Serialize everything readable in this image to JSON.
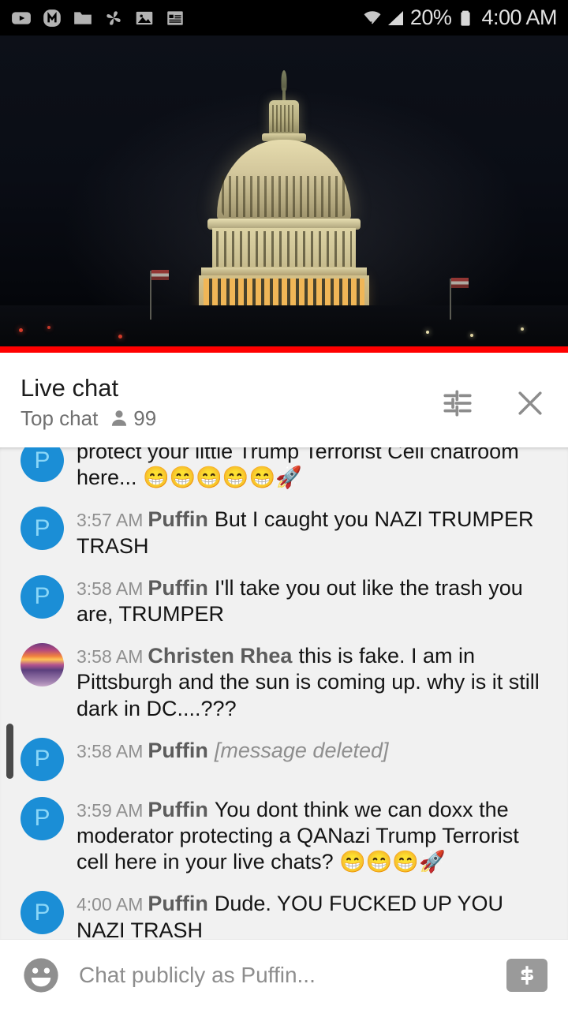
{
  "status_bar": {
    "background": "#000000",
    "left_icons": [
      {
        "name": "youtube-icon",
        "label": "YouTube"
      },
      {
        "name": "messenger-m-icon",
        "label": "M"
      },
      {
        "name": "folder-icon",
        "label": "Folder"
      },
      {
        "name": "photos-pinwheel-icon",
        "label": "Photos"
      },
      {
        "name": "image-icon",
        "label": "Gallery"
      },
      {
        "name": "notepad-icon",
        "label": "Notes"
      }
    ],
    "wifi_icon": "wifi-data-icon",
    "signal_icon": "cell-signal-icon",
    "battery_percent": "20%",
    "battery_icon": "battery-icon",
    "clock": "4:00 AM"
  },
  "video": {
    "name": "us-capitol-dome-night-livestream",
    "progress_color": "#ff0000",
    "progress_percent": 100
  },
  "chat_header": {
    "title": "Live chat",
    "mode": "Top chat",
    "viewer_icon": "person-icon",
    "viewer_count": "99",
    "settings_icon": "chat-settings-tuner-icon",
    "close_icon": "close-icon"
  },
  "chat_messages": [
    {
      "avatar_type": "letter",
      "avatar_letter": "P",
      "avatar_color": "#1b8ed6",
      "time": "",
      "author": "",
      "text": "protect your little Trump Terrorist Cell chatroom here... 😁😁😁😁😁🚀",
      "deleted": false,
      "clipped": true
    },
    {
      "avatar_type": "letter",
      "avatar_letter": "P",
      "avatar_color": "#1b8ed6",
      "time": "3:57 AM",
      "author": "Puffin",
      "text": "But I caught you NAZI TRUMPER TRASH",
      "deleted": false
    },
    {
      "avatar_type": "letter",
      "avatar_letter": "P",
      "avatar_color": "#1b8ed6",
      "time": "3:58 AM",
      "author": "Puffin",
      "text": "I'll take you out like the trash you are, TRUMPER",
      "deleted": false
    },
    {
      "avatar_type": "photo",
      "avatar_letter": "",
      "avatar_color": "#8a4f8e",
      "time": "3:58 AM",
      "author": "Christen Rhea",
      "text": "this is fake. I am in Pittsburgh and the sun is coming up. why is it still dark in DC....???",
      "deleted": false
    },
    {
      "avatar_type": "letter",
      "avatar_letter": "P",
      "avatar_color": "#1b8ed6",
      "time": "3:58 AM",
      "author": "Puffin",
      "text": "[message deleted]",
      "deleted": true
    },
    {
      "avatar_type": "letter",
      "avatar_letter": "P",
      "avatar_color": "#1b8ed6",
      "time": "3:59 AM",
      "author": "Puffin",
      "text": "You dont think we can doxx the moderator protecting a QANazi Trump Terrorist cell here in your live chats? 😁😁😁🚀",
      "deleted": false
    },
    {
      "avatar_type": "letter",
      "avatar_letter": "P",
      "avatar_color": "#1b8ed6",
      "time": "4:00 AM",
      "author": "Puffin",
      "text": "Dude. YOU FUCKED UP YOU NAZI TRASH",
      "deleted": false
    }
  ],
  "chat_input": {
    "emoji_icon": "emoji-smiley-icon",
    "placeholder": "Chat publicly as Puffin...",
    "value": "",
    "superchat_icon": "dollar-superchat-icon"
  }
}
